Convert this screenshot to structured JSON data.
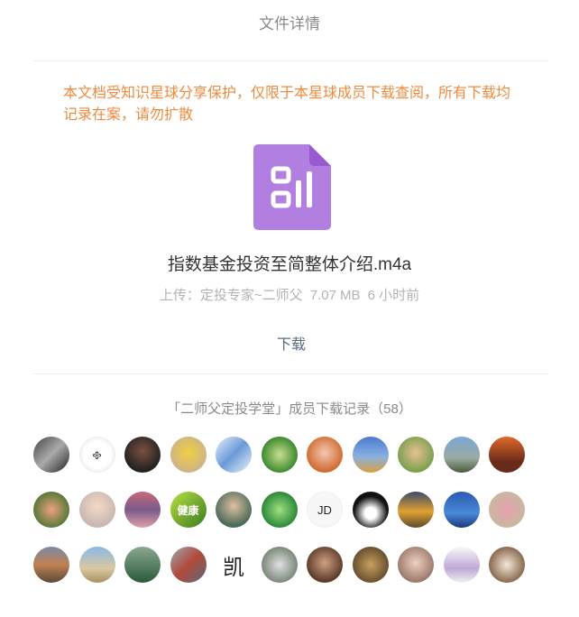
{
  "header": {
    "title": "文件详情"
  },
  "notice": "本文档受知识星球分享保护，仅限于本星球成员下载查阅，所有下载均记录在案，请勿扩散",
  "file": {
    "icon": "audio-file-icon",
    "icon_color": "#b07fe0",
    "name": "指数基金投资至简整体介绍.m4a",
    "uploader": "上传：定投专家~二师父",
    "size": "7.07 MB",
    "time": "6 小时前"
  },
  "download_label": "下载",
  "records": {
    "title": "「二师父定投学堂」成员下载记录（58）",
    "avatars": [
      {
        "bg": "linear-gradient(135deg,#444,#aaa 50%,#222)",
        "text": ""
      },
      {
        "bg": "radial-gradient(circle,#fff 55%,#ddd)",
        "text": "𐫱",
        "bordered": true
      },
      {
        "bg": "radial-gradient(circle at 50% 40%,#7a5040,#222 70%)",
        "text": ""
      },
      {
        "bg": "radial-gradient(circle at 50% 45%,#f0d040,#cdb487 70%)",
        "text": ""
      },
      {
        "bg": "linear-gradient(135deg,#e8f0fa,#6a9ad8 50%,#f0f5fb)",
        "text": ""
      },
      {
        "bg": "radial-gradient(circle,#c8e090,#3e8a30 70%)",
        "text": ""
      },
      {
        "bg": "radial-gradient(circle at 50% 45%,#f4c8b0,#d06a30 70%)",
        "text": ""
      },
      {
        "bg": "linear-gradient(180deg,#4a7ad0,#8ab0e0 55%,#d8a040)",
        "text": ""
      },
      {
        "bg": "radial-gradient(circle at 50% 45%,#e8c090,#7aa050 70%)",
        "text": ""
      },
      {
        "bg": "linear-gradient(180deg,#7aa8d8,#9aaaa0 60%,#4a5a3a)",
        "text": ""
      },
      {
        "bg": "linear-gradient(180deg,#e06a2a,#6a2a1a 70%)",
        "text": ""
      },
      {
        "bg": "radial-gradient(circle,#f0a080,#5a7a3a 70%)",
        "text": ""
      },
      {
        "bg": "radial-gradient(circle at 50% 40%,#f4d8c8,#c8b8b0 70%)",
        "text": ""
      },
      {
        "bg": "linear-gradient(180deg,#c86a7a,#7a5a8a 50%,#e0a0a8)",
        "text": ""
      },
      {
        "bg": "linear-gradient(135deg,#b8e040,#3a7a20)",
        "text": "健康"
      },
      {
        "bg": "radial-gradient(circle at 50% 40%,#e0c0a0,#4a6a5a 70%)",
        "text": ""
      },
      {
        "bg": "radial-gradient(circle,#a0e080,#2a8a3a 70%)",
        "text": ""
      },
      {
        "bg": "#f7f7f7",
        "text": "JD",
        "bordered": true
      },
      {
        "bg": "radial-gradient(circle at 50% 60%,#fff 20%,#111 60%)",
        "text": ""
      },
      {
        "bg": "linear-gradient(180deg,#3a4a6a,#e0a030 55%,#5a4a2a)",
        "text": ""
      },
      {
        "bg": "linear-gradient(180deg,#2a5ab0,#4a8ad8 60%,#1a3a7a)",
        "text": ""
      },
      {
        "bg": "radial-gradient(circle,#e8a0b0,#c8b8a0 70%)",
        "text": ""
      },
      {
        "bg": "linear-gradient(180deg,#7a8aa8,#c08050 50%,#5a4a3a)",
        "text": ""
      },
      {
        "bg": "linear-gradient(180deg,#8ab8e8,#d8c8a0 60%,#a89060)",
        "text": ""
      },
      {
        "bg": "linear-gradient(180deg,#8aa890,#2a5a3a)",
        "text": ""
      },
      {
        "bg": "linear-gradient(135deg,#a0a8b0,#b04a3a 50%,#5a6a7a)",
        "text": ""
      },
      {
        "bg": "#ffffff",
        "text": "凯",
        "bordered": false
      },
      {
        "bg": "radial-gradient(circle,#e0e0e0,#7a8a7a 70%)",
        "text": ""
      },
      {
        "bg": "radial-gradient(circle at 50% 45%,#d0a080,#5a3a2a 70%)",
        "text": ""
      },
      {
        "bg": "radial-gradient(circle,#c8a060,#6a5030 70%)",
        "text": ""
      },
      {
        "bg": "radial-gradient(circle at 50% 45%,#f0d0c0,#9a7a6a 70%)",
        "text": ""
      },
      {
        "bg": "linear-gradient(180deg,#f8f8f8,#c0a8d8 60%,#f0f0f0)",
        "text": ""
      },
      {
        "bg": "radial-gradient(circle,#f4e8d8,#8a6a50 70%)",
        "text": ""
      }
    ]
  }
}
